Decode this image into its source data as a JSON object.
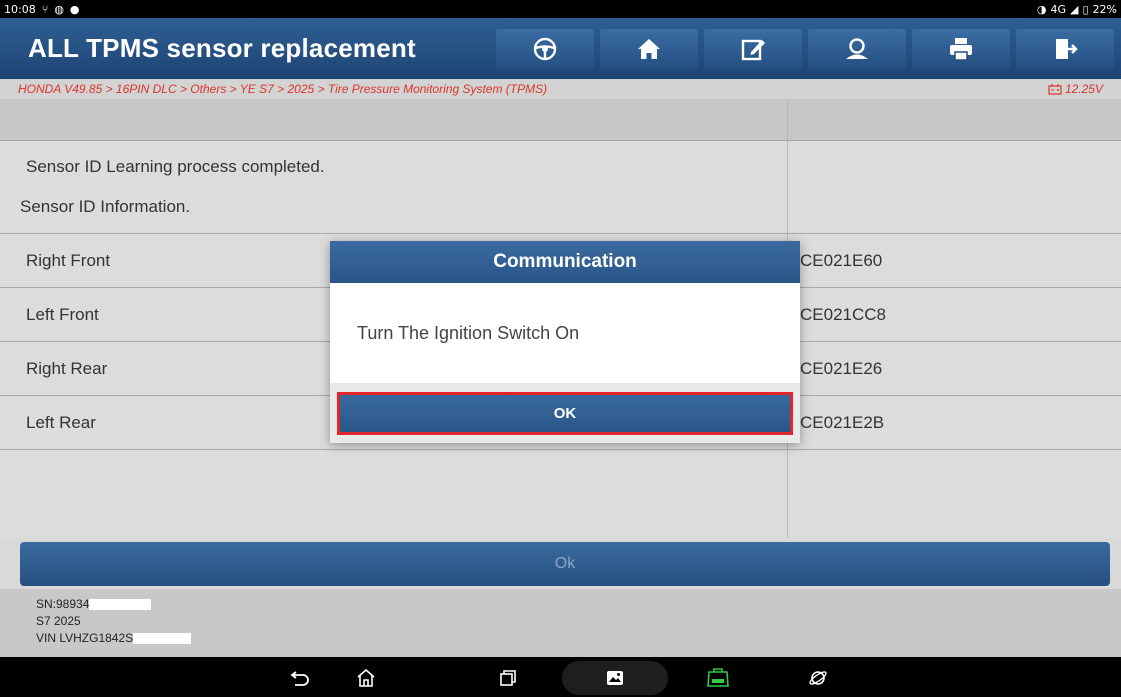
{
  "status_bar": {
    "time": "10:08",
    "network": "4G",
    "battery": "22%"
  },
  "header": {
    "title": "ALL TPMS sensor replacement",
    "toolbar": [
      {
        "name": "steering-wheel-icon"
      },
      {
        "name": "home-icon"
      },
      {
        "name": "report-edit-icon"
      },
      {
        "name": "profile-icon"
      },
      {
        "name": "print-icon"
      },
      {
        "name": "exit-icon"
      }
    ]
  },
  "breadcrumb": {
    "path": "HONDA V49.85 > 16PIN DLC > Others > YE S7 > 2025 > Tire Pressure Monitoring System (TPMS)",
    "voltage": "12.25V"
  },
  "table": {
    "message_line1": "Sensor ID Learning process completed.",
    "message_line2": "Sensor ID Information.",
    "rows": [
      {
        "label": "Right Front",
        "value": "CE021E60"
      },
      {
        "label": "Left Front",
        "value": "CE021CC8"
      },
      {
        "label": "Right Rear",
        "value": "CE021E26"
      },
      {
        "label": "Left Rear",
        "value": "CE021E2B"
      }
    ]
  },
  "bottom_button": {
    "label": "Ok"
  },
  "footer": {
    "sn": "SN:98934",
    "model": "S7 2025",
    "vin": "VIN LVHZG1842S"
  },
  "dialog": {
    "title": "Communication",
    "message": "Turn The Ignition Switch On",
    "ok_label": "OK"
  },
  "colors": {
    "header_blue": "#244f82",
    "breadcrumb_red": "#d9362b",
    "highlight_red": "#e0262b",
    "vci_green": "#2ecc40"
  }
}
